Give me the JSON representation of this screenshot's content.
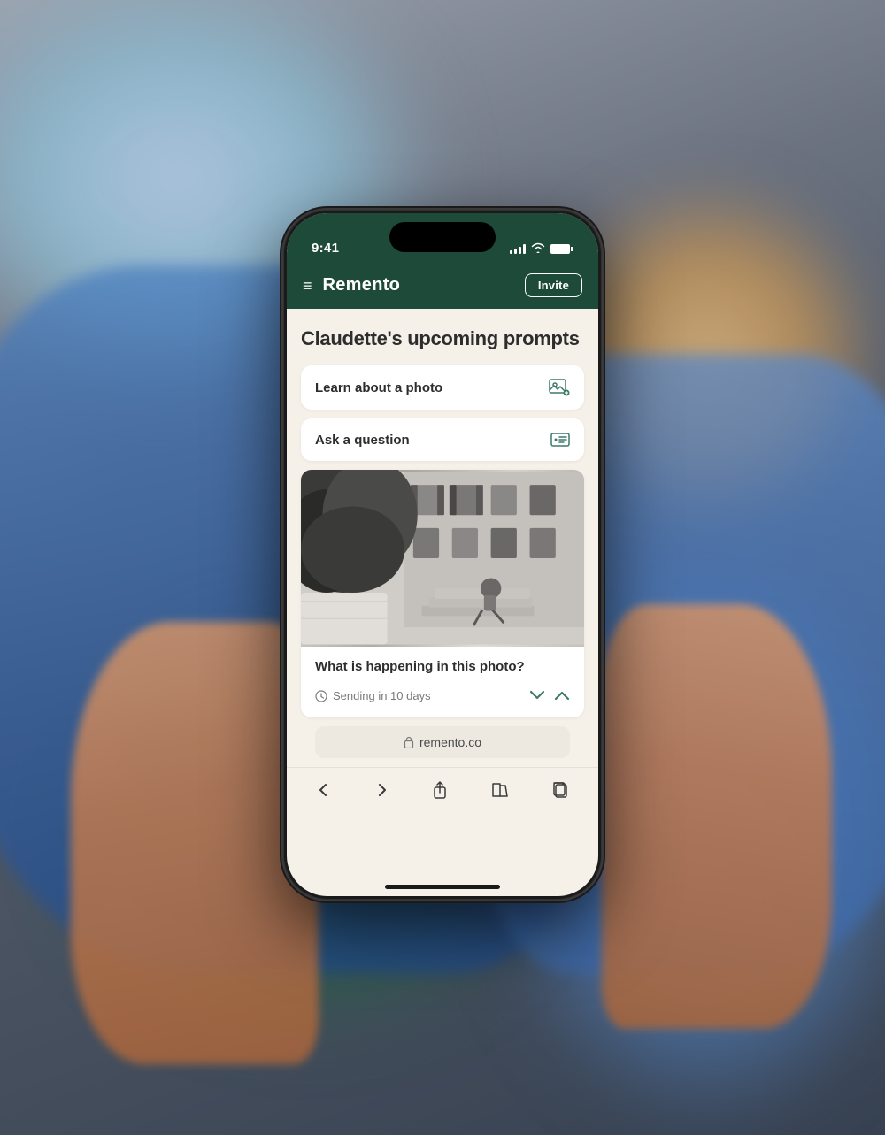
{
  "background": {
    "color": "#6b7280"
  },
  "phone": {
    "status_bar": {
      "time": "9:41",
      "signal_label": "signal",
      "wifi_label": "wifi",
      "battery_label": "battery"
    },
    "header": {
      "menu_icon": "☰",
      "title": "Remento",
      "invite_button": "Invite"
    },
    "content": {
      "page_title": "Claudette's upcoming prompts",
      "prompt_cards": [
        {
          "label": "Learn about a photo",
          "icon": "🖼"
        },
        {
          "label": "Ask a question",
          "icon": "📋"
        }
      ],
      "photo_card": {
        "caption": "What is happening in this photo?",
        "sending_info": "Sending in 10 days",
        "alt_text": "Black and white photo of a woman sitting on steps"
      }
    },
    "browser_bar": {
      "url": "remento.co",
      "lock_icon": "🔒"
    },
    "bottom_nav": {
      "back_icon": "<",
      "forward_icon": ">",
      "share_icon": "⬆",
      "books_icon": "📖",
      "copy_icon": "⧉"
    }
  }
}
